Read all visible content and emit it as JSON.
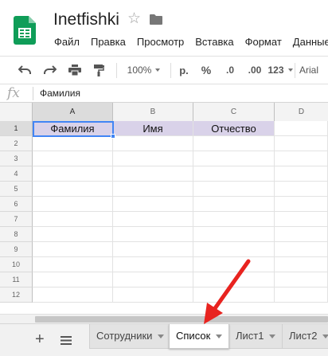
{
  "app": {
    "title": "Inetfishki",
    "menu": [
      "Файл",
      "Правка",
      "Просмотр",
      "Вставка",
      "Формат",
      "Данные"
    ]
  },
  "toolbar": {
    "zoom": "100%",
    "currency": "р.",
    "percent": "%",
    "decrease_decimals": ".0",
    "increase_decimals": ".00",
    "more_formats": "123",
    "font": "Arial"
  },
  "formula_bar": {
    "fx": "fx",
    "value": "Фамилия"
  },
  "grid": {
    "columns": [
      "A",
      "B",
      "C",
      "D"
    ],
    "rows": [
      "1",
      "2",
      "3",
      "4",
      "5",
      "6",
      "7",
      "8",
      "9",
      "10",
      "11",
      "12"
    ],
    "header_row_values": [
      "Фамилия",
      "Имя",
      "Отчество",
      ""
    ],
    "selected_cell": "A1",
    "header_fill_color": "#d9d2e9",
    "selection_color": "#4285f4"
  },
  "sheet_tabs": {
    "add_label": "+",
    "tabs": [
      {
        "label": "Сотрудники"
      },
      {
        "label": "Список"
      },
      {
        "label": "Лист1"
      },
      {
        "label": "Лист2"
      }
    ],
    "active": "Список"
  },
  "colors": {
    "annotation_arrow": "#e8231f",
    "logo_green": "#0f9d58"
  }
}
